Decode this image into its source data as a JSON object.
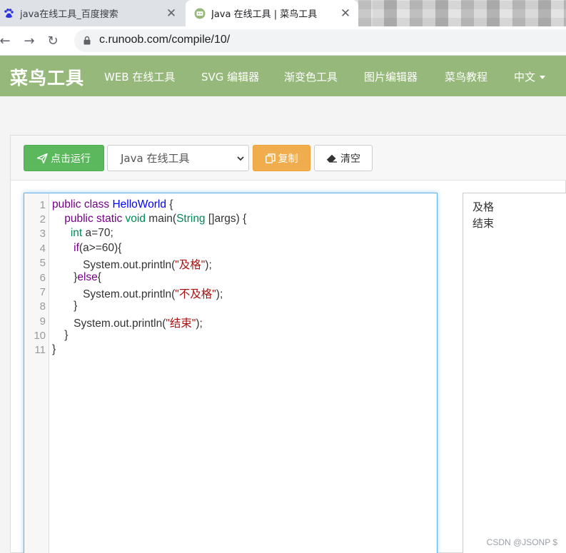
{
  "browser": {
    "tabs": [
      {
        "title": "java在线工具_百度搜索",
        "icon": "baidu-paw-icon",
        "active": false
      },
      {
        "title": "Java 在线工具 | 菜鸟工具",
        "icon": "runoob-bird-icon",
        "active": true
      }
    ],
    "url": "c.runoob.com/compile/10/"
  },
  "site": {
    "brand": "菜鸟工具",
    "nav": [
      "WEB 在线工具",
      "SVG 编辑器",
      "渐变色工具",
      "图片编辑器",
      "菜鸟教程",
      "中文"
    ],
    "accent": "#96b97b"
  },
  "toolbar": {
    "run_label": "点击运行",
    "language_selected": "Java 在线工具",
    "copy_label": "复制",
    "clear_label": "清空"
  },
  "editor": {
    "line_numbers": [
      "1",
      "2",
      "3",
      "4",
      "5",
      "6",
      "7",
      "8",
      "9",
      "10",
      "11"
    ],
    "lines": [
      "public class HelloWorld {",
      "    public static void main(String []args) {",
      "      int a=70;",
      "       if(a>=60){",
      "          System.out.println(\"及格\");",
      "       }else{",
      "          System.out.println(\"不及格\");",
      "       }",
      "       System.out.println(\"结束\");",
      "    }",
      "}"
    ]
  },
  "output": {
    "lines": [
      "及格",
      "结束"
    ]
  },
  "watermark": "CSDN @JSONP $"
}
